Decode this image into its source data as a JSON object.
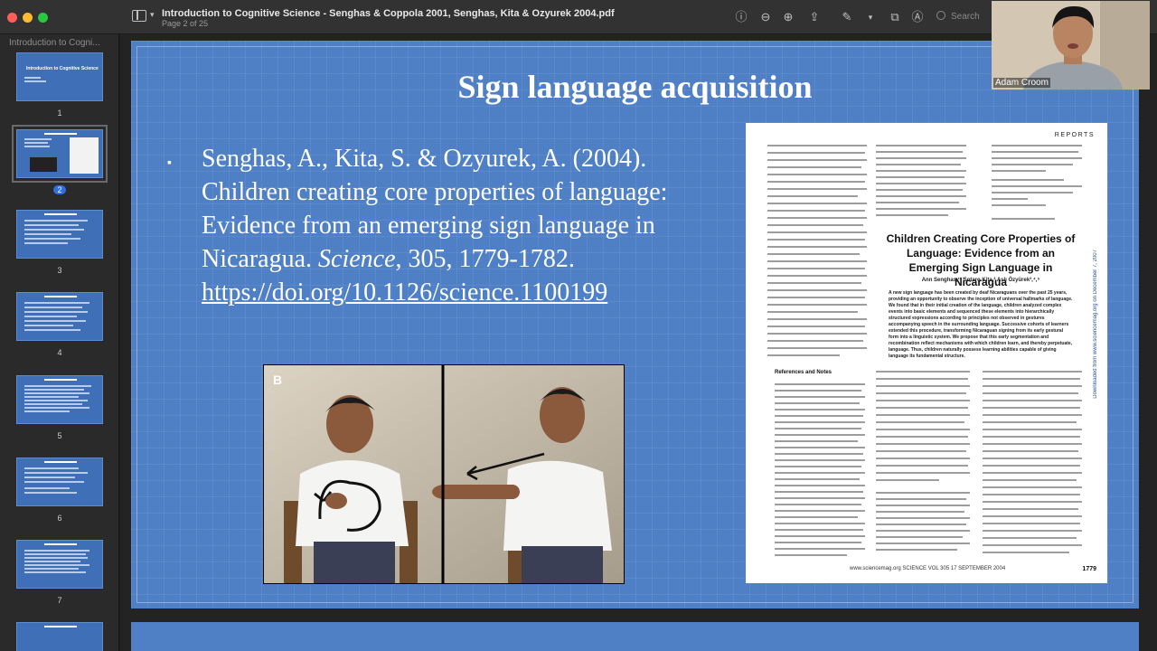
{
  "window": {
    "title": "Introduction to Cognitive Science - Senghas & Coppola 2001, Senghas, Kita & Ozyurek 2004.pdf",
    "page_indicator": "Page 2 of 25"
  },
  "toolbar": {
    "search_placeholder": "Search",
    "icons": [
      "sidebar-icon",
      "info-icon",
      "zoom-out-icon",
      "zoom-in-icon",
      "share-icon",
      "markup-pen-icon",
      "chevron-down-icon",
      "rotate-icon",
      "annotate-icon",
      "search-icon"
    ]
  },
  "sidebar": {
    "title": "Introduction to Cogni...",
    "thumbnails": [
      {
        "num": "1",
        "title": "Introduction to Cognitive Science"
      },
      {
        "num": "2",
        "selected": true
      },
      {
        "num": "3"
      },
      {
        "num": "4"
      },
      {
        "num": "5"
      },
      {
        "num": "6"
      },
      {
        "num": "7"
      }
    ]
  },
  "slide": {
    "title": "Sign language acquisition",
    "bullet": "▪",
    "citation_text": "Senghas, A., Kita, S. & Ozyurek, A. (2004). Children creating core properties of language: Evidence from an emerging sign language in Nicaragua.",
    "citation_journal": "Science",
    "citation_tail": ", 305, 1779-1782.",
    "doi": "https://doi.org/10.1126/science.1100199",
    "photo_label": "B"
  },
  "article": {
    "section": "REPORTS",
    "title": "Children Creating Core Properties of Language: Evidence from an Emerging Sign Language in Nicaragua",
    "authors": "Ann Senghas,¹* Sotaro Kita,² Aslı Özyürek³,⁴,⁵",
    "abstract": "A new sign language has been created by deaf Nicaraguans over the past 25 years, providing an opportunity to observe the inception of universal hallmarks of language. We found that in their initial creation of the language, children analyzed complex events into basic elements and sequenced these elements into hierarchically structured expressions according to principles not observed in gestures accompanying speech in the surrounding language. Successive cohorts of learners extended this procedure, transforming Nicaraguan signing from its early gestural form into a linguistic system. We propose that this early segmentation and recombination reflect mechanisms with which children learn, and thereby perpetuate, language. Thus, children naturally possess learning abilities capable of giving language its fundamental structure.",
    "references_heading": "References and Notes",
    "footer": "www.sciencemag.org   SCIENCE   VOL 305   17 SEPTEMBER 2004",
    "page_number": "1779",
    "download_note": "Downloaded from www.sciencemag.org on December 7, 2007"
  },
  "webcam": {
    "name": "Adam Croom"
  },
  "colors": {
    "slide_bg": "#4f7fc4",
    "toolbar_bg": "#323232",
    "sidebar_bg": "#2a2a2a",
    "selected_badge": "#2f6fe0"
  }
}
